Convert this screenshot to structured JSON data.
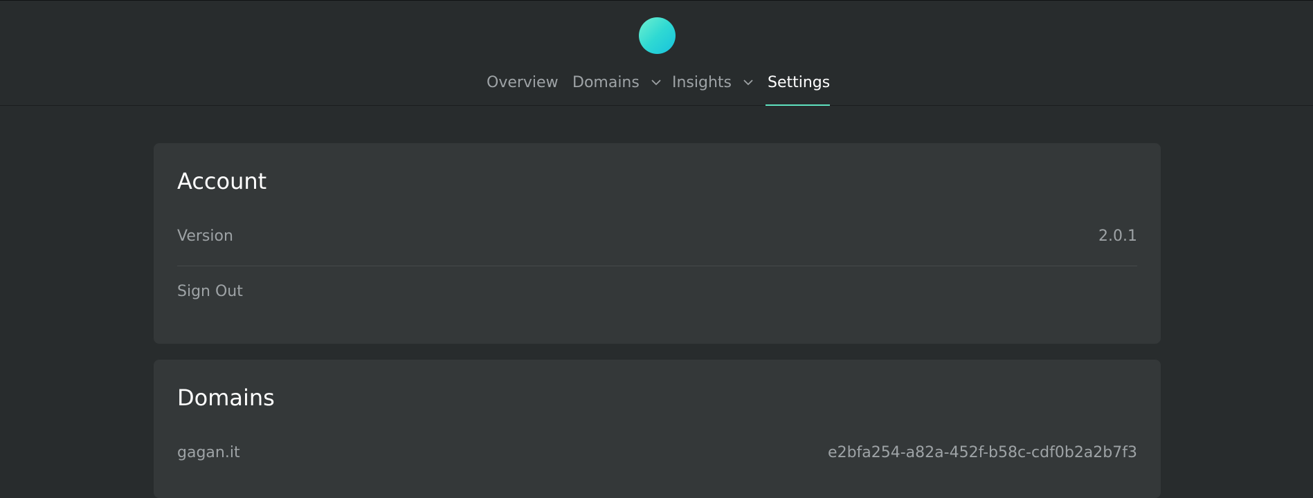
{
  "header": {
    "logo": "app-logo",
    "nav": [
      {
        "label": "Overview",
        "has_dropdown": false,
        "active": false
      },
      {
        "label": "Domains",
        "has_dropdown": true,
        "active": false
      },
      {
        "label": "Insights",
        "has_dropdown": true,
        "active": false
      },
      {
        "label": "Settings",
        "has_dropdown": false,
        "active": true
      }
    ]
  },
  "account": {
    "title": "Account",
    "version_label": "Version",
    "version_value": "2.0.1",
    "sign_out_label": "Sign Out"
  },
  "domains": {
    "title": "Domains",
    "items": [
      {
        "name": "gagan.it",
        "id": "e2bfa254-a82a-452f-b58c-cdf0b2a2b7f3"
      }
    ]
  },
  "colors": {
    "background": "#282c2d",
    "card": "#343839",
    "accent": "#5fe3c0",
    "text_muted": "#9ea3a6",
    "text_primary": "#ffffff"
  },
  "icons": {
    "dropdown": "chevron-down-icon"
  }
}
